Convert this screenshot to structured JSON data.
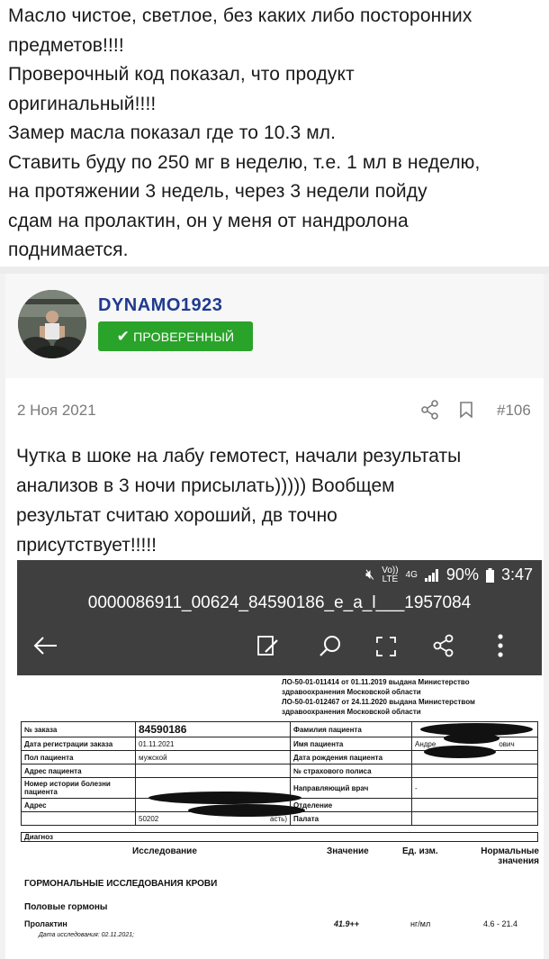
{
  "post_top": {
    "lines": [
      "Масло чистое, светлое, без каких либо посторонних",
      "предметов!!!!",
      "Проверочный код показал, что продукт",
      "оригинальный!!!!",
      "Замер масла показал где то 10.3 мл.",
      "Ставить буду по 250 мг в неделю, т.е. 1 мл в неделю,",
      "на протяжении 3 недель, через 3 недели пойду",
      "сдам на пролактин, он у меня от нандролона",
      "поднимается."
    ]
  },
  "user": {
    "name": "DYNAMO1923",
    "badge": "ПРОВЕРЕННЫЙ",
    "badge_color": "#29a329",
    "name_color": "#1f3a8f"
  },
  "post": {
    "date": "2 Ноя 2021",
    "number": "#106",
    "lines": [
      "Чутка в шоке на лабу гемотест, начали результаты",
      "анализов в 3 ночи присылать))))) Вообщем",
      "результат считаю хороший, дв точно",
      "присутствует!!!!!"
    ]
  },
  "phone": {
    "status": {
      "volte": "Vo))\nLTE",
      "net": "4G",
      "battery": "90%",
      "time": "3:47"
    },
    "file_title": "0000086911_00624_84590186_e_a_l___1957084"
  },
  "lab": {
    "license_lines": [
      "ЛО-50-01-011414 от 01.11.2019 выдана Министерство",
      "здравоохранения Московской области",
      "ЛО-50-01-012467 от 24.11.2020 выдана Министерством",
      "здравоохранения Московской области"
    ],
    "order_label": "№ заказа",
    "order_value": "84590186",
    "reg_date_label": "Дата регистрации заказа",
    "reg_date_value": "01.11.2021",
    "gender_label": "Пол пациента",
    "gender_value": "мужской",
    "address_patient_label": "Адрес пациента",
    "history_label": "Номер истории болезни пациента",
    "address_label": "Адрес",
    "address_partial": "50202",
    "address_suffix": "асть)",
    "surname_label": "Фамилия пациента",
    "name_label": "Имя пациента",
    "name_partial": "Андре",
    "patronymic_partial": "ович",
    "birth_label": "Дата рождения пациента",
    "policy_label": "№ страхового полиса",
    "doctor_label": "Направляющий врач",
    "doctor_value": "-",
    "department_label": "Отделение",
    "ward_label": "Палата",
    "diagnosis_label": "Диагноз",
    "col_test": "Исследование",
    "col_value": "Значение",
    "col_unit": "Ед. изм.",
    "col_norm": "Нормальные значения",
    "section_main": "ГОРМОНАЛЬНЫЕ ИССЛЕДОВАНИЯ КРОВИ",
    "section_sub": "Половые гормоны",
    "test_name": "Пролактин",
    "test_value": "41.9++",
    "test_unit": "нг/мл",
    "test_norm": "4.6 - 21.4",
    "test_date": "Дата исследования: 02.11.2021;"
  }
}
